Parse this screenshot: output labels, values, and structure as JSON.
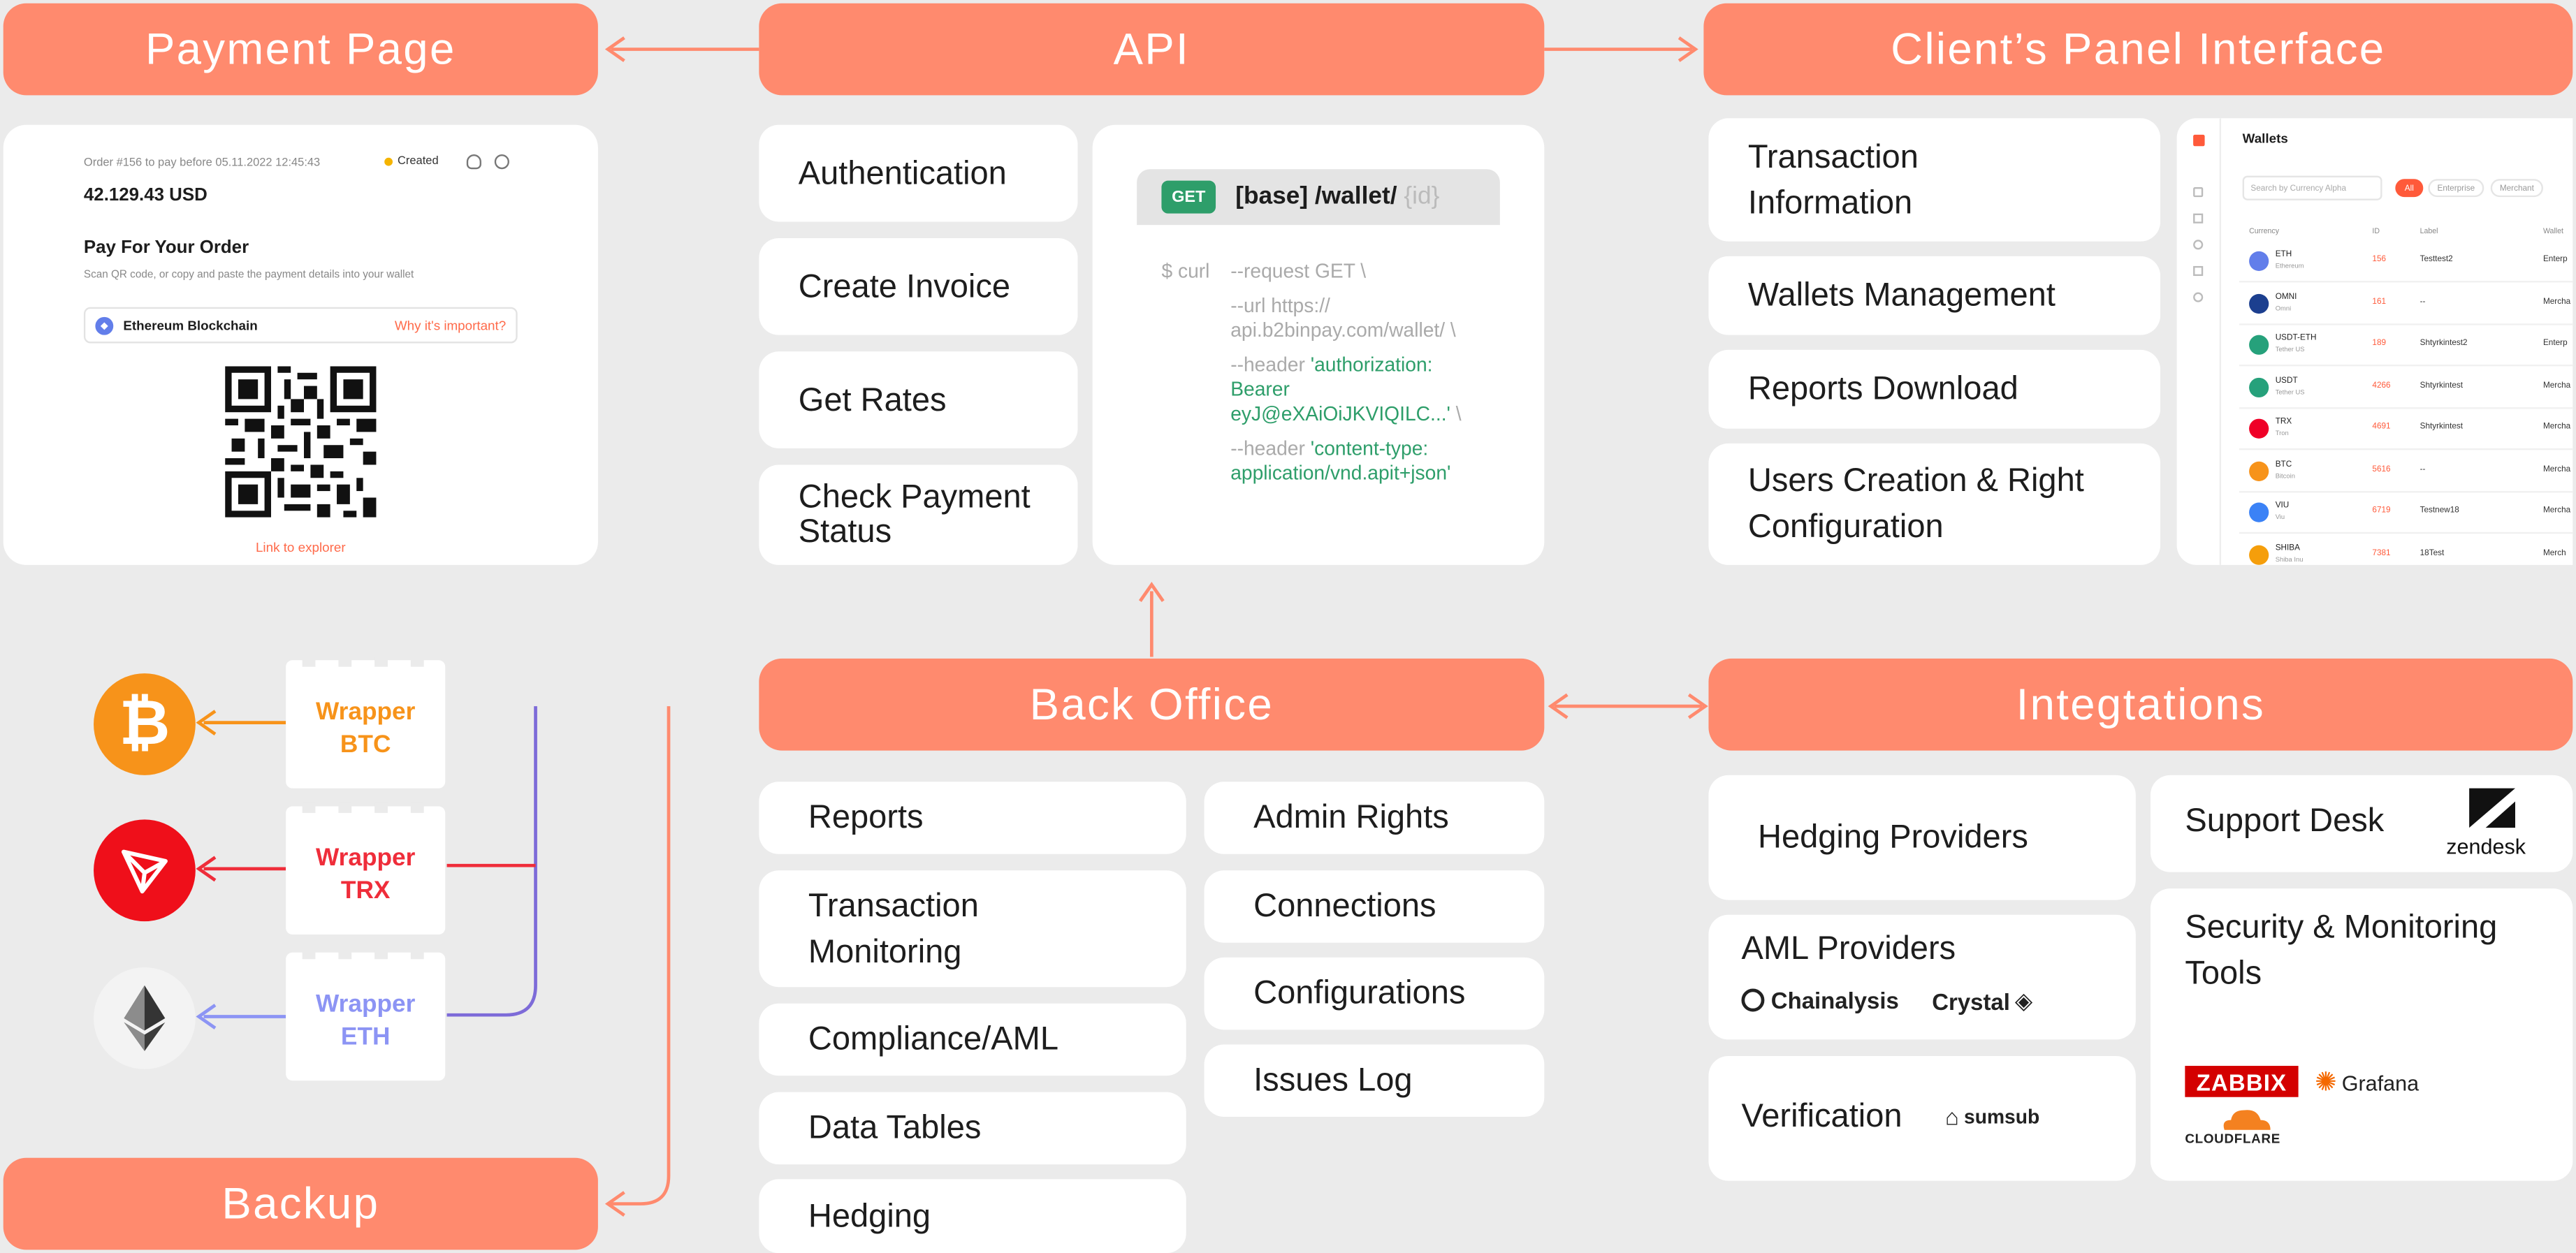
{
  "headers": {
    "payment_page": "Payment Page",
    "api": "API",
    "clients_panel": "Client’s Panel Interface",
    "back_office": "Back Office",
    "integrations": "Integtations",
    "backup": "Backup"
  },
  "payment": {
    "order": "Order #156 to pay before 05.11.2022 12:45:43",
    "status": "Created",
    "amount": "42.129.43 USD",
    "title": "Pay For Your Order",
    "instruction": "Scan QR code, or copy and paste the payment details into your wallet",
    "network": "Ethereum Blockchain",
    "why": "Why it's important?",
    "explorer": "Link to explorer"
  },
  "api": {
    "items": [
      "Authentication",
      "Create Invoice",
      "Get Rates",
      "Check Payment Status"
    ],
    "method": "GET",
    "endpoint": "[base] /wallet/",
    "endpoint_param": "{id}",
    "curl": "$ curl",
    "c1": "--request GET \\",
    "c2a": "--url https://",
    "c2b": "api.b2binpay.com/wallet/ \\",
    "c3": "--header",
    "c3a": "'authorization:",
    "c3b": "Bearer",
    "c3c": "eyJ@eXAiOiJKVIQILC...'",
    "c3d": " \\",
    "c4": "--header",
    "c4a": "'content-type:",
    "c4b": "application/vnd.apit+json'"
  },
  "client": {
    "items": [
      "Transaction Information",
      "Wallets Management",
      "Reports Download",
      "Users Creation & Right Configuration"
    ],
    "wallets_title": "Wallets",
    "search_placeholder": "Search by Currency Alpha",
    "filters": [
      "All",
      "Enterprise",
      "Merchant"
    ],
    "columns": [
      "Currency",
      "ID",
      "Label",
      "Wallet"
    ],
    "rows": [
      {
        "sym": "ETH",
        "name": "Ethereum",
        "id": "156",
        "label": "Testtest2",
        "type": "Enterp",
        "color": "#627eea"
      },
      {
        "sym": "OMNI",
        "name": "Omni",
        "id": "161",
        "label": "--",
        "type": "Mercha",
        "color": "#1c3f8f"
      },
      {
        "sym": "USDT-ETH",
        "name": "Tether US",
        "id": "189",
        "label": "Shtyrkintest2",
        "type": "Enterp",
        "color": "#26a17b"
      },
      {
        "sym": "USDT",
        "name": "Tether US",
        "id": "4266",
        "label": "Shtyrkintest",
        "type": "Mercha",
        "color": "#26a17b"
      },
      {
        "sym": "TRX",
        "name": "Tron",
        "id": "4691",
        "label": "Shtyrkintest",
        "type": "Mercha",
        "color": "#ef0027"
      },
      {
        "sym": "BTC",
        "name": "Bitcoin",
        "id": "5616",
        "label": "--",
        "type": "Mercha",
        "color": "#f7931a"
      },
      {
        "sym": "VIU",
        "name": "Viu",
        "id": "6719",
        "label": "Testnew18",
        "type": "Mercha",
        "color": "#3b82f6"
      },
      {
        "sym": "SHIBA",
        "name": "Shiba Inu",
        "id": "7381",
        "label": "18Test",
        "type": "Merch",
        "color": "#f59e0b"
      }
    ]
  },
  "wrappers": [
    {
      "line1": "Wrapper",
      "line2": "BTC",
      "color": "#f7931a"
    },
    {
      "line1": "Wrapper",
      "line2": "TRX",
      "color": "#ef2d3a"
    },
    {
      "line1": "Wrapper",
      "line2": "ETH",
      "color": "#8c94f4"
    }
  ],
  "back_office": {
    "left": [
      "Reports",
      "Transaction Monitoring",
      "Compliance/AML",
      "Data Tables",
      "Hedging"
    ],
    "right": [
      "Admin Rights",
      "Connections",
      "Configurations",
      "Issues Log"
    ]
  },
  "integrations": {
    "hedging": "Hedging Providers",
    "aml": "AML Providers",
    "chainalysis": "Chainalysis",
    "crystal": "Crystal",
    "verification": "Verification",
    "sumsub": "sumsub",
    "support": "Support Desk",
    "zendesk": "zendesk",
    "security": "Security & Monitoring Tools",
    "zabbix": "ZABBIX",
    "grafana": "Grafana",
    "cloudflare": "CLOUDFLARE"
  },
  "colors": {
    "accent": "#ff8a6e",
    "btc": "#f7931a",
    "trx": "#ef2d3a",
    "eth": "#8c94f4",
    "green": "#2e9e6a"
  }
}
